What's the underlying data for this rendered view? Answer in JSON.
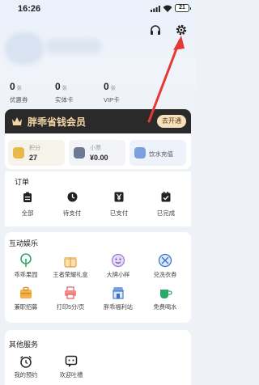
{
  "status_bar": {
    "time": "16:26",
    "battery": "21"
  },
  "stats": [
    {
      "num": "0",
      "unit": "张",
      "label": "优惠券"
    },
    {
      "num": "0",
      "unit": "张",
      "label": "实体卡"
    },
    {
      "num": "0",
      "unit": "张",
      "label": "VIP卡"
    }
  ],
  "member": {
    "title": "胖乖省钱会员",
    "button": "去开通"
  },
  "wallet": {
    "points_label": "积分",
    "points_value": "27",
    "vault_label": "小票",
    "vault_value": "¥0.00",
    "water_label": "饮水充值"
  },
  "orders": {
    "title": "订单",
    "items": [
      {
        "label": "全部",
        "icon": "clipboard-icon"
      },
      {
        "label": "待支付",
        "icon": "clock-icon"
      },
      {
        "label": "已支付",
        "icon": "yen-icon"
      },
      {
        "label": "已完成",
        "icon": "check-icon"
      }
    ]
  },
  "fun": {
    "title": "互动娱乐",
    "items": [
      {
        "label": "乖乖果园",
        "icon": "tree-icon"
      },
      {
        "label": "王者荣耀礼盒",
        "icon": "gift-icon"
      },
      {
        "label": "大牌小样",
        "icon": "smile-icon"
      },
      {
        "label": "兑洗衣券",
        "icon": "ticket-icon"
      },
      {
        "label": "兼职招募",
        "icon": "briefcase-icon"
      },
      {
        "label": "打印5分/页",
        "icon": "printer-icon"
      },
      {
        "label": "胖乖福利站",
        "icon": "store-icon"
      },
      {
        "label": "免费喝水",
        "icon": "cup-icon"
      }
    ]
  },
  "other": {
    "title": "其他服务",
    "items": [
      {
        "label": "我的预约",
        "icon": "alarm-icon"
      },
      {
        "label": "欢迎吐槽",
        "icon": "feedback-icon"
      }
    ]
  },
  "colors": {
    "accent_green": "#2ea86a",
    "member_bg": "#2a2a2a",
    "member_text": "#f3d6a6",
    "arrow_red": "#e53935"
  }
}
